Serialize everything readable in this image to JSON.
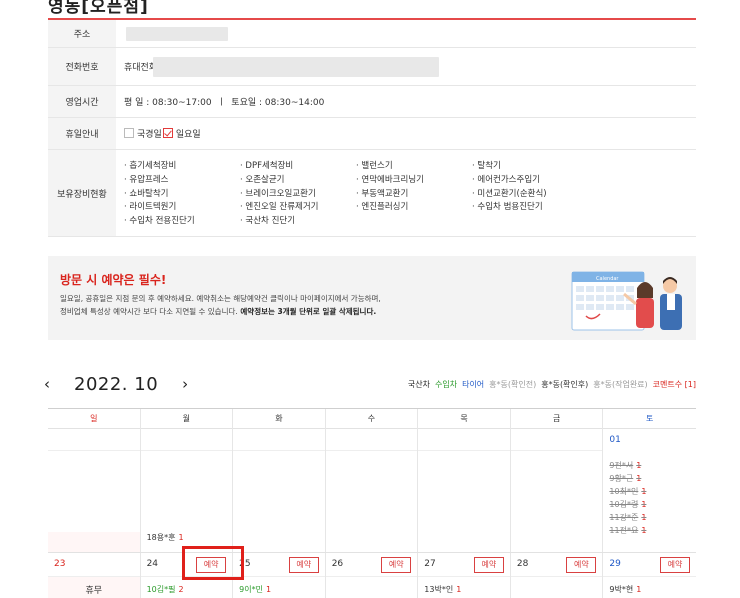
{
  "shop": {
    "title": "영동[오픈점]"
  },
  "info": {
    "address_label": "주소",
    "phone_label": "전화번호",
    "phone_prefix": "휴대전화",
    "hours_label": "영업시간",
    "hours_value": "평 일 : 08:30~17:00  ㅣ  토요일 : 08:30~14:00",
    "holiday_label": "휴일안내",
    "holiday_options": [
      {
        "label": "국경일",
        "checked": false
      },
      {
        "label": "일요일",
        "checked": true
      }
    ],
    "equipment_label": "보유장비현황",
    "equipment": [
      "· 흡기세척장비",
      "· DPF세척장비",
      "· 밸런스기",
      "· 탈착기",
      "· 유압프레스",
      "· 오존살균기",
      "· 연막에바크리닝기",
      "· 에어컨가스주입기",
      "· 쇼바탈착기",
      "· 브레이크오일교환기",
      "· 부동액교환기",
      "· 미션교환기(순환식)",
      "· 라이트텍원기",
      "· 엔진오일 잔류제거기",
      "· 엔진플러싱기",
      "· 수입차 범용진단기",
      "· 수입차 전용진단기",
      "· 국산차 진단기"
    ]
  },
  "banner": {
    "title": "방문 시 예약은 필수!",
    "line1": "일요일, 공휴일은 지점 문의 후 예약하세요. 예약취소는 해당예약건 클릭이나 마이페이지에서 가능하며,",
    "line2_plain": "정비업체 특성상 예약시간 보다 다소 지연될 수 있습니다.",
    "line2_bold": " 예약정보는 3개월 단위로 일괄 삭제됩니다.",
    "calendar_text": "Calendar"
  },
  "calendar": {
    "month_label": "2022. 10",
    "prev_icon": "‹",
    "next_icon": "›",
    "legend": [
      {
        "text": "국산차",
        "color": "#222222"
      },
      {
        "text": "수입차",
        "color": "#2a9a2a"
      },
      {
        "text": "타이어",
        "color": "#1f58c6"
      },
      {
        "text": "홍*동(확인전)",
        "color": "#999999"
      },
      {
        "text": "홍*동(확인후)",
        "color": "#333333"
      },
      {
        "text": "홍*동(작업완료)",
        "color": "#999999"
      },
      {
        "text": "코멘트수 [1]",
        "color": "#d9241d"
      }
    ],
    "weekdays": [
      "일",
      "월",
      "화",
      "수",
      "목",
      "금",
      "토"
    ],
    "reserve_label": "예약",
    "week1": {
      "sat_date": "01",
      "mon_entry": {
        "name": "18용*훈",
        "count": "1"
      },
      "sat_entries": [
        {
          "name": "9전*서",
          "count": "1"
        },
        {
          "name": "9황*근",
          "count": "1"
        },
        {
          "name": "10최*인",
          "count": "1"
        },
        {
          "name": "10김*령",
          "count": "1"
        },
        {
          "name": "11강*준",
          "count": "1"
        },
        {
          "name": "11전*요",
          "count": "1"
        }
      ]
    },
    "week2": {
      "dates": [
        "23",
        "24",
        "25",
        "26",
        "27",
        "28",
        "29"
      ],
      "sun_note": "휴무",
      "mon_entry": {
        "name": "10김*필",
        "count": "2"
      },
      "tue_entry": {
        "name": "9이*민",
        "count": "1"
      },
      "thu_entry": {
        "name": "13박*인",
        "count": "1"
      },
      "sat_entry": {
        "name": "9박*현",
        "count": "1"
      }
    }
  }
}
